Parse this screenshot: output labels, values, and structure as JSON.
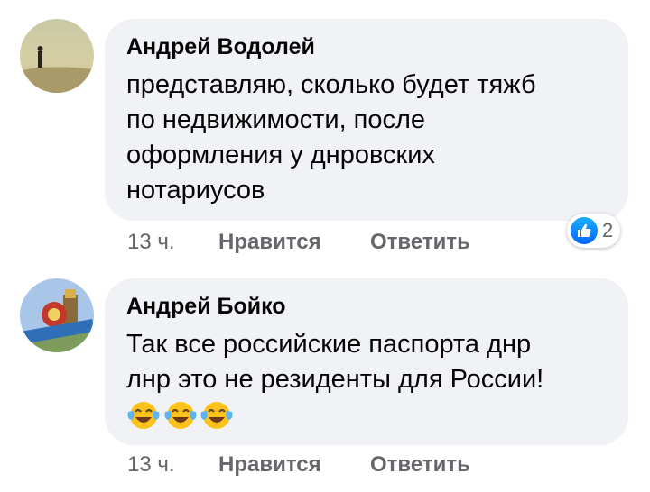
{
  "comments": [
    {
      "author": "Андрей Водолей",
      "lines": [
        "представляю, сколько будет тяжб",
        "по недвижимости, после",
        "оформления у днровских",
        "нотариусов"
      ],
      "time": "13 ч.",
      "like_label": "Нравится",
      "reply_label": "Ответить",
      "reaction_count": "2",
      "reaction_icon": "thumbs-up-icon"
    },
    {
      "author": "Андрей Бойко",
      "lines": [
        "Так все российские паспорта днр",
        "лнр это не резиденты для России!"
      ],
      "emojis": [
        "tears-of-joy-icon",
        "tears-of-joy-icon",
        "tears-of-joy-icon"
      ],
      "time": "13 ч.",
      "like_label": "Нравится",
      "reply_label": "Ответить"
    }
  ],
  "colors": {
    "bubble": "#f0f2f5",
    "text": "#050505",
    "meta": "#65676b",
    "like_badge": "#0866ff"
  }
}
